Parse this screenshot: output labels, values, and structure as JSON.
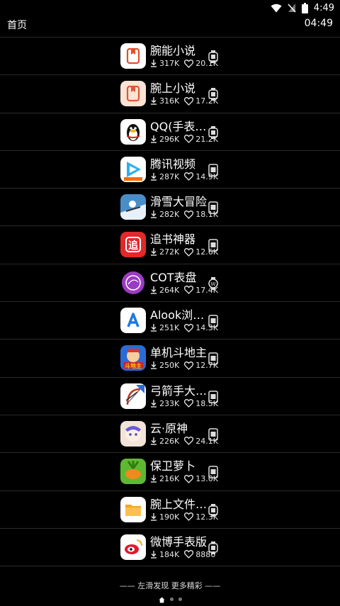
{
  "status_bar": {
    "time": "4:49"
  },
  "header": {
    "title": "首页",
    "clock": "04:49"
  },
  "apps": [
    {
      "name": "腕能小说",
      "downloads": "317K",
      "likes": "20.1K",
      "icon": "book-icon",
      "icon_bg": "#ffffff",
      "icon_fg": "#e0502c",
      "watch": "watch-icon"
    },
    {
      "name": "腕上小说",
      "downloads": "316K",
      "likes": "17.2K",
      "icon": "book-icon",
      "icon_bg": "#fde3d4",
      "icon_fg": "#d85a3a",
      "watch": "watch-icon"
    },
    {
      "name": "QQ(手表…",
      "downloads": "296K",
      "likes": "21.2K",
      "icon": "penguin-icon",
      "icon_bg": "#ffffff",
      "icon_fg": "#111111",
      "watch": "watch-icon"
    },
    {
      "name": "腾讯视频",
      "downloads": "287K",
      "likes": "14.9K",
      "icon": "video-play-icon",
      "icon_bg": "#ffffff",
      "icon_fg": "#2bb0f0",
      "watch": "phone-icon"
    },
    {
      "name": "滑雪大冒险",
      "downloads": "282K",
      "likes": "18.1K",
      "icon": "ski-game-icon",
      "icon_bg": "#4a8ec8",
      "icon_fg": "#ffffff",
      "watch": "phone-icon"
    },
    {
      "name": "追书神器",
      "downloads": "272K",
      "likes": "12.6K",
      "icon": "zhui-icon",
      "icon_bg": "#e22828",
      "icon_fg": "#ffffff",
      "watch": "phone-icon"
    },
    {
      "name": "COT表盘",
      "downloads": "264K",
      "likes": "17.4K",
      "icon": "watchface-icon",
      "icon_bg": "#000000",
      "icon_fg": "#9b3bc4",
      "watch": "watch-w-icon"
    },
    {
      "name": "Alook浏…",
      "downloads": "251K",
      "likes": "14.3K",
      "icon": "alook-icon",
      "icon_bg": "#ffffff",
      "icon_fg": "#1a7be0",
      "watch": "phone-icon"
    },
    {
      "name": "单机斗地主",
      "downloads": "250K",
      "likes": "12.7K",
      "icon": "card-game-icon",
      "icon_bg": "#2c6ad6",
      "icon_fg": "#f7c51e",
      "watch": "phone-icon"
    },
    {
      "name": "弓箭手大…",
      "downloads": "233K",
      "likes": "18.5K",
      "icon": "bow-icon",
      "icon_bg": "#ffffff",
      "icon_fg": "#c0392b",
      "watch": "phone-icon"
    },
    {
      "name": "云·原神",
      "downloads": "226K",
      "likes": "24.1K",
      "icon": "genshin-icon",
      "icon_bg": "#f2e4d8",
      "icon_fg": "#6a5ad6",
      "watch": "phone-icon"
    },
    {
      "name": "保卫萝卜",
      "downloads": "216K",
      "likes": "13.0K",
      "icon": "carrot-icon",
      "icon_bg": "#5fb832",
      "icon_fg": "#f08a1c",
      "watch": "phone-icon"
    },
    {
      "name": "腕上文件…",
      "downloads": "190K",
      "likes": "12.3K",
      "icon": "folder-icon",
      "icon_bg": "#ffffff",
      "icon_fg": "#f5a623",
      "watch": "watch-icon"
    },
    {
      "name": "微博手表版",
      "downloads": "184K",
      "likes": "8886",
      "icon": "weibo-icon",
      "icon_bg": "#ffffff",
      "icon_fg": "#e6162d",
      "watch": "watch-icon"
    }
  ],
  "footer": {
    "text": "—— 左滑发现 更多精彩 ——"
  },
  "pager": {
    "pages": 3,
    "active": 0
  }
}
